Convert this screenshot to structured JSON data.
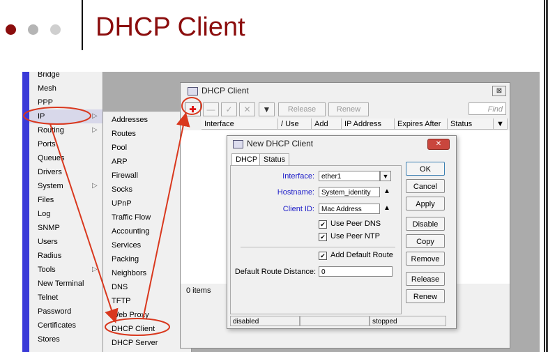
{
  "slide": {
    "title": "DHCP Client"
  },
  "menu": {
    "items": [
      {
        "label": "Bridge",
        "arrow": ""
      },
      {
        "label": "Mesh",
        "arrow": ""
      },
      {
        "label": "PPP",
        "arrow": ""
      },
      {
        "label": "IP",
        "arrow": "▷"
      },
      {
        "label": "Routing",
        "arrow": "▷"
      },
      {
        "label": "Ports",
        "arrow": ""
      },
      {
        "label": "Queues",
        "arrow": ""
      },
      {
        "label": "Drivers",
        "arrow": ""
      },
      {
        "label": "System",
        "arrow": "▷"
      },
      {
        "label": "Files",
        "arrow": ""
      },
      {
        "label": "Log",
        "arrow": ""
      },
      {
        "label": "SNMP",
        "arrow": ""
      },
      {
        "label": "Users",
        "arrow": ""
      },
      {
        "label": "Radius",
        "arrow": ""
      },
      {
        "label": "Tools",
        "arrow": "▷"
      },
      {
        "label": "New Terminal",
        "arrow": ""
      },
      {
        "label": "Telnet",
        "arrow": ""
      },
      {
        "label": "Password",
        "arrow": ""
      },
      {
        "label": "Certificates",
        "arrow": ""
      },
      {
        "label": "Stores",
        "arrow": ""
      }
    ]
  },
  "submenu": {
    "items": [
      "Addresses",
      "Routes",
      "Pool",
      "ARP",
      "Firewall",
      "Socks",
      "UPnP",
      "Traffic Flow",
      "Accounting",
      "Services",
      "Packing",
      "Neighbors",
      "DNS",
      "TFTP",
      "Web Proxy",
      "DHCP Client",
      "DHCP Server"
    ]
  },
  "window": {
    "title": "DHCP Client",
    "close": "⊠",
    "toolbar": {
      "add": "✚",
      "remove": "—",
      "enable": "✓",
      "disable": "✕",
      "filter": "▼",
      "release": "Release",
      "renew": "Renew",
      "find_placeholder": "Find"
    },
    "columns": [
      "Interface",
      "/ Use P...",
      "Add D...",
      "IP Address",
      "Expires After",
      "Status"
    ],
    "items_count": "0 items"
  },
  "dialog": {
    "title": "New DHCP Client",
    "close": "✕",
    "tabs": [
      "DHCP",
      "Status"
    ],
    "fields": {
      "interface_label": "Interface:",
      "interface_value": "ether1",
      "hostname_label": "Hostname:",
      "hostname_value": "System_identity",
      "clientid_label": "Client ID:",
      "clientid_value": "Mac Address",
      "route_distance_label": "Default Route Distance:",
      "route_distance_value": "0"
    },
    "checkboxes": {
      "use_peer_dns": "Use Peer DNS",
      "use_peer_ntp": "Use Peer NTP",
      "add_default_route": "Add Default Route"
    },
    "buttons": [
      "OK",
      "Cancel",
      "Apply",
      "Disable",
      "Copy",
      "Remove",
      "Release",
      "Renew"
    ],
    "status_left": "disabled",
    "status_right": "stopped"
  },
  "colors": {
    "title": "#8b0d0d",
    "annotation": "#d9381e",
    "label_blue": "#1a1ac8"
  }
}
